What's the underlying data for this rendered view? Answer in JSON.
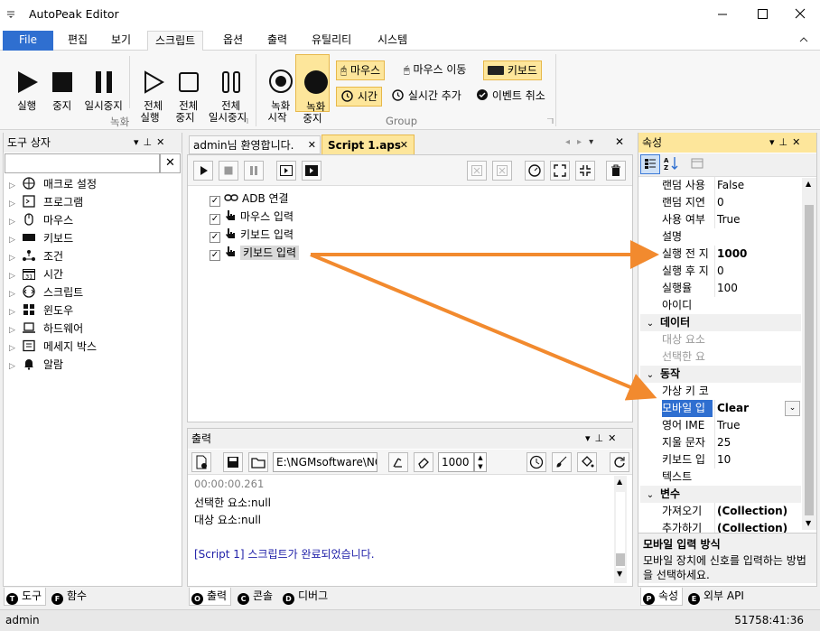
{
  "window": {
    "title": "AutoPeak Editor",
    "controls": [
      "minimize",
      "maximize",
      "close"
    ]
  },
  "menu_tabs": [
    "File",
    "편집",
    "보기",
    "스크립트",
    "옵션",
    "출력",
    "유틸리티",
    "시스템"
  ],
  "ribbon": {
    "rec_group_buttons": [
      {
        "label": "실행",
        "icon": "play-icon"
      },
      {
        "label": "중지",
        "icon": "stop-icon"
      },
      {
        "label": "일시중지",
        "icon": "pause-icon"
      },
      {
        "label": "전체\n실행",
        "icon": "play-all-icon"
      },
      {
        "label": "전체\n중지",
        "icon": "stop-all-icon"
      },
      {
        "label": "전체\n일시중지",
        "icon": "pause-all-icon"
      }
    ],
    "rec_group_label": "녹화",
    "record_start": "녹화\n시작",
    "record_stop": "녹화\n중지",
    "small_buttons": {
      "mouse": "마우스",
      "mouse_move": "마우스 이동",
      "keyboard": "키보드",
      "time": "시간",
      "realtime_add": "실시간 추가",
      "event_cancel": "이벤트 취소"
    },
    "group2_label": "Group"
  },
  "toolbox": {
    "title": "도구 상자",
    "search_value": "",
    "items": [
      {
        "label": "매크로 설정",
        "icon": "globe-icon"
      },
      {
        "label": "프로그램",
        "icon": "program-icon"
      },
      {
        "label": "마우스",
        "icon": "mouse-icon"
      },
      {
        "label": "키보드",
        "icon": "keyboard-icon"
      },
      {
        "label": "조건",
        "icon": "condition-icon"
      },
      {
        "label": "시간",
        "icon": "calendar-icon"
      },
      {
        "label": "스크립트",
        "icon": "script-icon"
      },
      {
        "label": "윈도우",
        "icon": "windows-icon"
      },
      {
        "label": "하드웨어",
        "icon": "laptop-icon"
      },
      {
        "label": "메세지 박스",
        "icon": "message-icon"
      },
      {
        "label": "알람",
        "icon": "bell-icon"
      }
    ],
    "calendar_day": "31",
    "bottom_tabs": [
      "도구",
      "함수"
    ]
  },
  "doc_tabs": [
    "admin님 환영합니다.",
    "Script 1.aps"
  ],
  "script_items": [
    {
      "label": "ADB 연결",
      "checked": true,
      "icon": "link-icon"
    },
    {
      "label": "마우스 입력",
      "checked": true,
      "icon": "hand-icon"
    },
    {
      "label": "키보드 입력",
      "checked": true,
      "icon": "hand-icon"
    },
    {
      "label": "키보드 입력",
      "checked": true,
      "icon": "hand-icon",
      "selected": true
    }
  ],
  "output": {
    "title": "출력",
    "path_value": "E:\\NGMsoftware\\NG",
    "count_value": "1000",
    "lines": [
      {
        "text": "00:00:00.261",
        "color": "#808080"
      },
      {
        "text": "선택한 요소:null",
        "color": "#000000"
      },
      {
        "text": "대상 요소:null",
        "color": "#000000"
      },
      {
        "text": "",
        "color": "#000000"
      },
      {
        "text": "[Script 1] 스크립트가 완료되었습니다.",
        "color": "#1f1fa8"
      }
    ],
    "bottom_tabs": [
      "출력",
      "콘솔",
      "디버그"
    ]
  },
  "properties": {
    "title": "속성",
    "rows": [
      {
        "type": "row",
        "key": "랜덤 사용",
        "value": "False"
      },
      {
        "type": "row",
        "key": "랜덤 지연",
        "value": "0"
      },
      {
        "type": "row",
        "key": "사용 여부",
        "value": "True"
      },
      {
        "type": "row",
        "key": "설명",
        "value": ""
      },
      {
        "type": "row",
        "key": "실행 전 지",
        "value": "1000",
        "bold": true
      },
      {
        "type": "row",
        "key": "실행 후 지",
        "value": "0"
      },
      {
        "type": "row",
        "key": "실행율",
        "value": "100"
      },
      {
        "type": "row",
        "key": "아이디",
        "value": ""
      },
      {
        "type": "cat",
        "key": "데이터"
      },
      {
        "type": "row",
        "key": "대상 요소",
        "value": "",
        "gray": true
      },
      {
        "type": "row",
        "key": "선택한 요",
        "value": "",
        "gray": true
      },
      {
        "type": "cat",
        "key": "동작"
      },
      {
        "type": "row",
        "key": "가상 키 코",
        "value": ""
      },
      {
        "type": "row",
        "key": "모바일 입",
        "value": "Clear",
        "bold": true,
        "selected": true
      },
      {
        "type": "row",
        "key": "영어 IME",
        "value": "True"
      },
      {
        "type": "row",
        "key": "지울 문자",
        "value": "25"
      },
      {
        "type": "row",
        "key": "키보드 입",
        "value": "10"
      },
      {
        "type": "row",
        "key": "텍스트",
        "value": ""
      },
      {
        "type": "cat",
        "key": "변수"
      },
      {
        "type": "row",
        "key": "가져오기",
        "value": "(Collection)",
        "bold": true
      },
      {
        "type": "row",
        "key": "추가하기",
        "value": "(Collection)",
        "bold": true
      }
    ],
    "desc_title": "모바일 입력 방식",
    "desc_text": "모바일 장치에 신호를 입력하는 방법을 선택하세요.",
    "bottom_tabs": [
      "속성",
      "외부 API"
    ]
  },
  "status": {
    "user": "admin",
    "time": "51758:41:36"
  },
  "colors": {
    "accent": "#2f6fd0",
    "highlight": "#fde69b",
    "arrow": "#f28a2e"
  }
}
